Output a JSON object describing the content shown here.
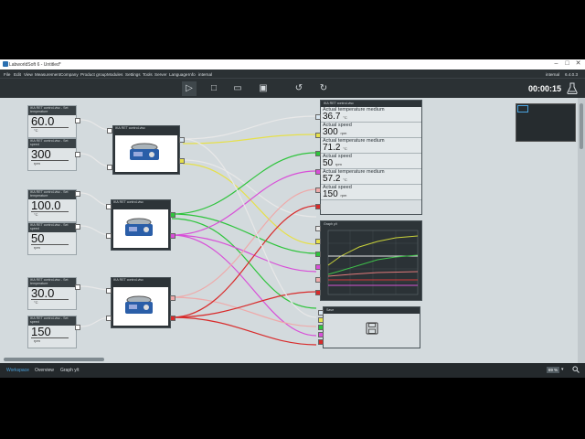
{
  "window": {
    "title": "LabworldSoft 6 - Untitled*",
    "min": "–",
    "max": "□",
    "close": "✕"
  },
  "menu": {
    "items": [
      "File",
      "Edit",
      "View",
      "Measurement",
      "Company",
      "Product group",
      "Modules",
      "Settings",
      "Tools",
      "Server",
      "Language",
      "Info",
      "internal"
    ],
    "right_user": "internal",
    "version": "6.4.0.3"
  },
  "toolbar": {
    "buttons": [
      {
        "name": "play-button",
        "glyph": "▷"
      },
      {
        "name": "stop-button",
        "glyph": "□"
      },
      {
        "name": "open-button",
        "glyph": "▭"
      },
      {
        "name": "save-button",
        "glyph": "▣"
      },
      {
        "name": "undo-button",
        "glyph": "↺"
      },
      {
        "name": "redo-button",
        "glyph": "↻"
      }
    ],
    "timer": "00:00:15"
  },
  "setters": [
    {
      "title": "IKA RET control-visc - Set temperature",
      "value": "60.0",
      "unit": "°C"
    },
    {
      "title": "IKA RET control-visc - Set speed",
      "value": "300",
      "unit": "rpm"
    },
    {
      "title": "IKA RET control-visc - Set temperature",
      "value": "100.0",
      "unit": "°C"
    },
    {
      "title": "IKA RET control-visc - Set speed",
      "value": "50",
      "unit": "rpm"
    },
    {
      "title": "IKA RET control-visc - Set temperature",
      "value": "30.0",
      "unit": "°C"
    },
    {
      "title": "IKA RET control-visc - Set speed",
      "value": "150",
      "unit": "rpm"
    }
  ],
  "devices": [
    {
      "title": "IKA RET control-visc"
    },
    {
      "title": "IKA RET control-visc"
    },
    {
      "title": "IKA RET control-visc"
    }
  ],
  "measurements": {
    "title": "IKA RET control-visc",
    "rows": [
      {
        "label": "Actual temperature medium",
        "value": "36.7",
        "unit": "°C"
      },
      {
        "label": "Actual speed",
        "value": "300",
        "unit": "rpm"
      },
      {
        "label": "Actual temperature medium",
        "value": "71.2",
        "unit": "°C"
      },
      {
        "label": "Actual speed",
        "value": "50",
        "unit": "rpm"
      },
      {
        "label": "Actual temperature medium",
        "value": "57.2",
        "unit": "°C"
      },
      {
        "label": "Actual speed",
        "value": "150",
        "unit": "rpm"
      }
    ]
  },
  "graph": {
    "title": "Graph y/t",
    "series_colors": [
      "#c9d23a",
      "#e5e5e5",
      "#3fbf4a",
      "#d455d4",
      "#e07a7a",
      "#d93a3a"
    ]
  },
  "save_panel": {
    "title": "Save"
  },
  "status": {
    "tabs": [
      "Workspace",
      "Overview",
      "Graph y/t"
    ],
    "zoom": "69 %"
  },
  "colors": {
    "green": "#2ec43c",
    "yellow": "#e6e04a",
    "magenta": "#d84fd8",
    "red": "#d82b2b",
    "pink": "#eeaaaa",
    "grey": "#e8e8e8"
  }
}
